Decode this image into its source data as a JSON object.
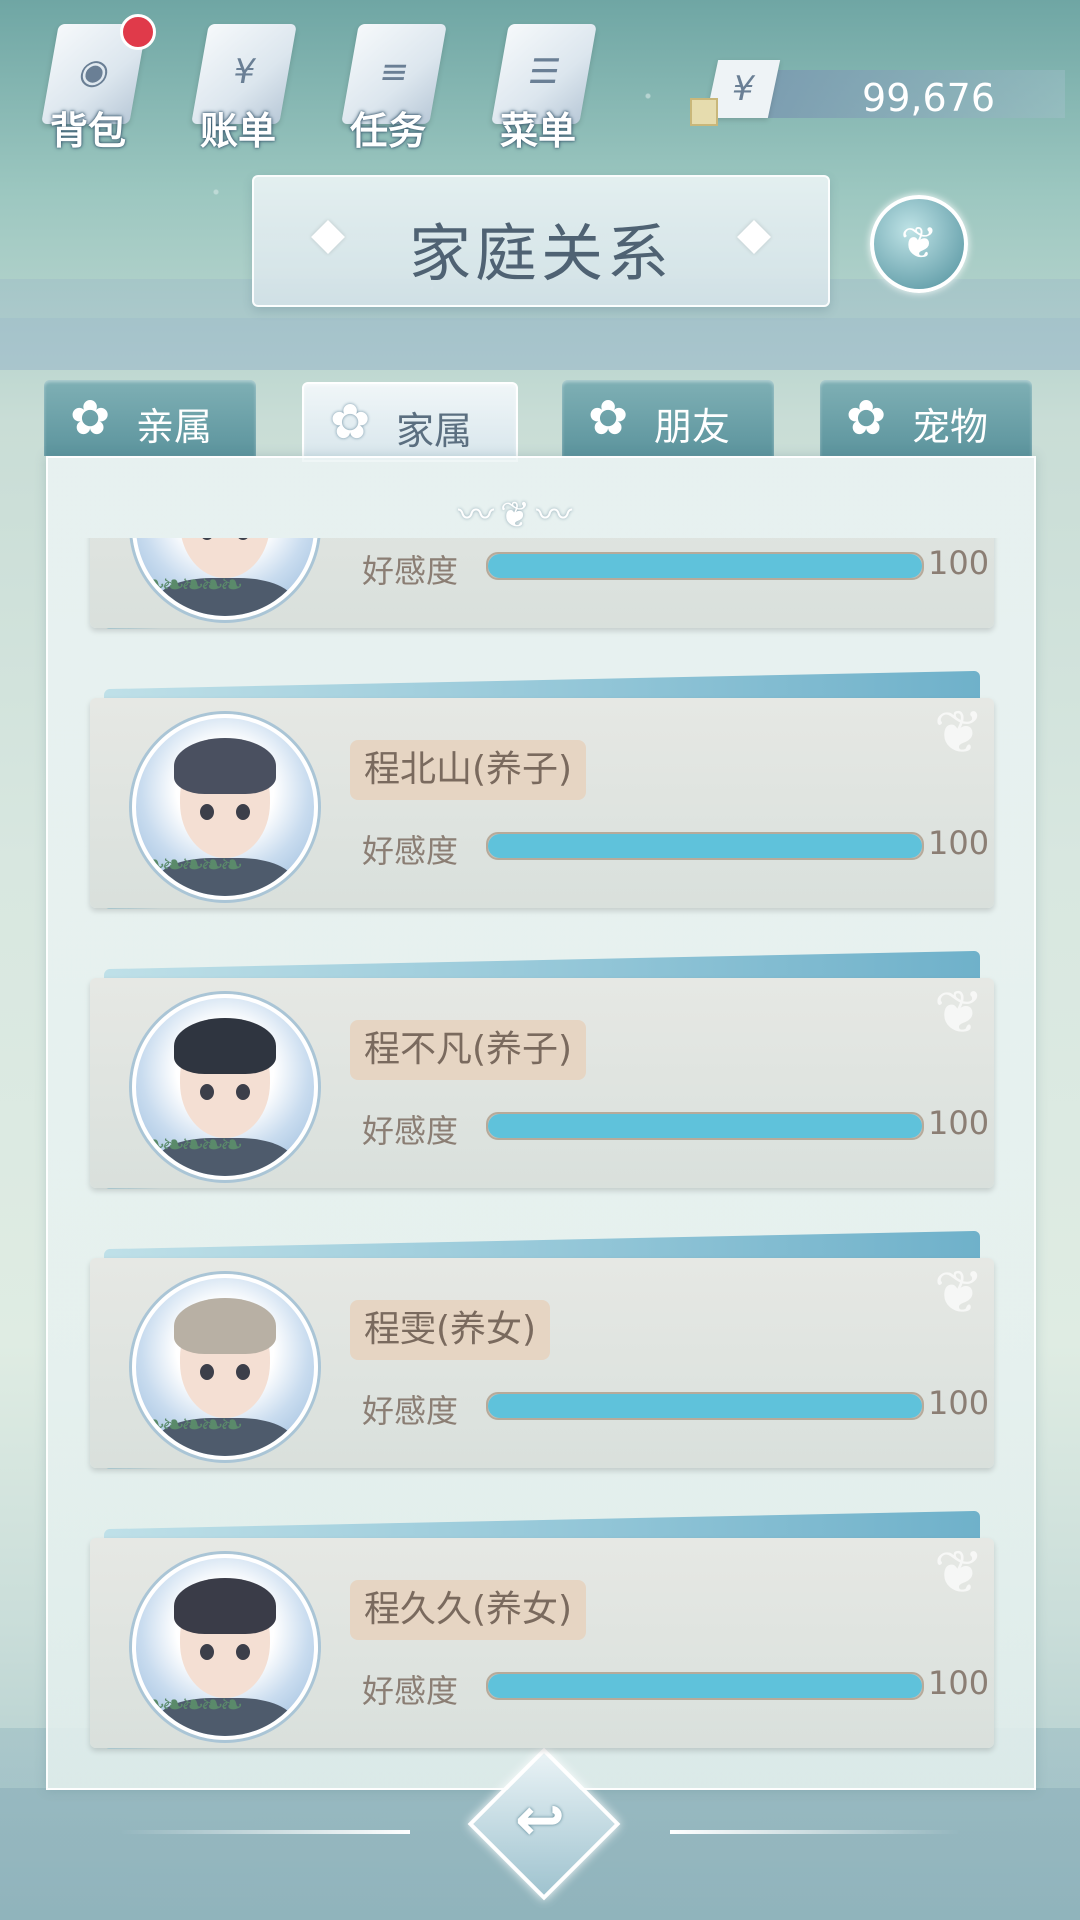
{
  "topbar": {
    "icons": [
      {
        "label": "背包",
        "icon": "backpack-icon",
        "glyph": "◉",
        "has_badge": true
      },
      {
        "label": "账单",
        "icon": "bill-icon",
        "glyph": "¥"
      },
      {
        "label": "任务",
        "icon": "task-icon",
        "glyph": "≡"
      },
      {
        "label": "菜单",
        "icon": "menu-icon",
        "glyph": "☰"
      }
    ],
    "currency": {
      "symbol": "¥",
      "value": "99,676"
    }
  },
  "title": "家庭关系",
  "tabs": [
    {
      "label": "亲属",
      "active": false
    },
    {
      "label": "家属",
      "active": true
    },
    {
      "label": "朋友",
      "active": false
    },
    {
      "label": "宠物",
      "active": false
    }
  ],
  "affinity_label": "好感度",
  "members": [
    {
      "name": "",
      "affinity": 100,
      "hair": "#2f2f33"
    },
    {
      "name": "程北山(养子)",
      "affinity": 100,
      "hair": "#4a5060"
    },
    {
      "name": "程不凡(养子)",
      "affinity": 100,
      "hair": "#2f3540"
    },
    {
      "name": "程雯(养女)",
      "affinity": 100,
      "hair": "#b8b0a4"
    },
    {
      "name": "程久久(养女)",
      "affinity": 100,
      "hair": "#3a3c48"
    }
  ],
  "colors": {
    "bar_fill": "#5fc2db",
    "badge": "#e03a4a"
  }
}
